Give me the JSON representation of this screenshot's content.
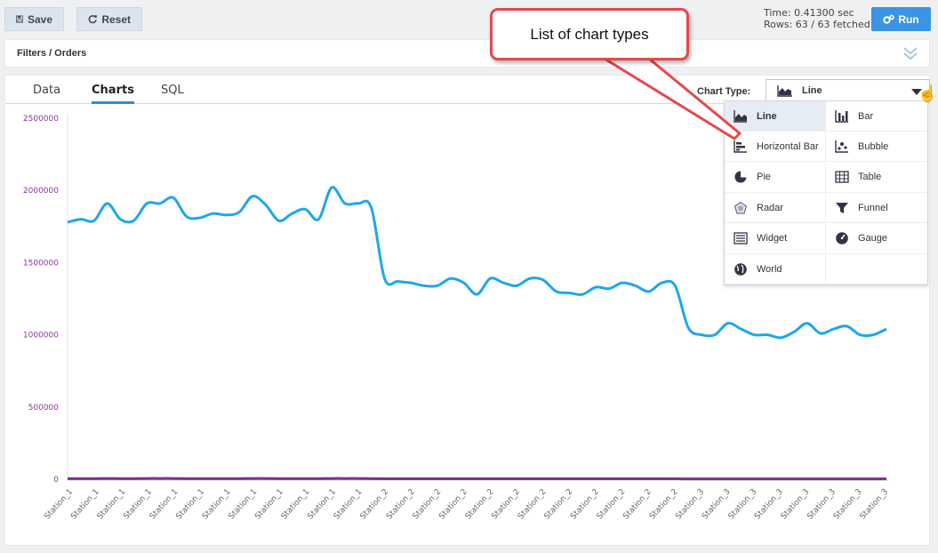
{
  "toolbar": {
    "save_label": "Save",
    "reset_label": "Reset",
    "time_text": "Time: 0.41300 sec",
    "rows_text": "Rows: 63 / 63 fetched",
    "run_label": "Run"
  },
  "filters": {
    "label": "Filters / Orders"
  },
  "tabs": [
    {
      "label": "Data",
      "active": false
    },
    {
      "label": "Charts",
      "active": true
    },
    {
      "label": "SQL",
      "active": false
    }
  ],
  "chart_type": {
    "label": "Chart Type:",
    "selected": "Line"
  },
  "dropdown": {
    "items": [
      {
        "label": "Line",
        "icon": "area-chart-icon",
        "selected": true
      },
      {
        "label": "Bar",
        "icon": "bar-chart-icon",
        "selected": false
      },
      {
        "label": "Horizontal Bar",
        "icon": "horizontal-bar-icon",
        "selected": false
      },
      {
        "label": "Bubble",
        "icon": "bubble-chart-icon",
        "selected": false
      },
      {
        "label": "Pie",
        "icon": "pie-chart-icon",
        "selected": false
      },
      {
        "label": "Table",
        "icon": "table-icon",
        "selected": false
      },
      {
        "label": "Radar",
        "icon": "radar-icon",
        "selected": false
      },
      {
        "label": "Funnel",
        "icon": "funnel-icon",
        "selected": false
      },
      {
        "label": "Widget",
        "icon": "widget-icon",
        "selected": false
      },
      {
        "label": "Gauge",
        "icon": "gauge-icon",
        "selected": false
      },
      {
        "label": "World",
        "icon": "globe-icon",
        "selected": false
      }
    ]
  },
  "callout": {
    "text": "List of chart types"
  },
  "colors": {
    "accent": "#2a8fd8",
    "run_button": "#3a95e4",
    "series_primary": "#1ea7ea",
    "series_secondary": "#7b2e96",
    "y_tick_text": "#8b3a9a",
    "callout_border": "#e5484b"
  },
  "chart_data": {
    "type": "line",
    "ylim": [
      0,
      2500000
    ],
    "yticks": [
      "0",
      "500000",
      "1000000",
      "1500000",
      "2000000",
      "2500000"
    ],
    "xticks": [
      "Station_1",
      "Station_1",
      "Station_1",
      "Station_1",
      "Station_1",
      "Station_1",
      "Station_1",
      "Station_1",
      "Station_1",
      "Station_1",
      "Station_1",
      "Station_1",
      "Station_2",
      "Station_2",
      "Station_2",
      "Station_2",
      "Station_2",
      "Station_2",
      "Station_2",
      "Station_2",
      "Station_2",
      "Station_2",
      "Station_2",
      "Station_2",
      "Station_3",
      "Station_3",
      "Station_3",
      "Station_3",
      "Station_3",
      "Station_3",
      "Station_3",
      "Station_3"
    ],
    "series": [
      {
        "values": [
          1780000,
          1800000,
          1790000,
          1910000,
          1800000,
          1790000,
          1910000,
          1910000,
          1950000,
          1820000,
          1810000,
          1840000,
          1830000,
          1850000,
          1960000,
          1900000,
          1790000,
          1840000,
          1870000,
          1800000,
          2020000,
          1910000,
          1910000,
          1880000,
          1390000,
          1370000,
          1360000,
          1340000,
          1340000,
          1390000,
          1360000,
          1280000,
          1390000,
          1360000,
          1340000,
          1390000,
          1380000,
          1300000,
          1290000,
          1280000,
          1330000,
          1320000,
          1360000,
          1340000,
          1300000,
          1360000,
          1340000,
          1050000,
          1000000,
          1000000,
          1080000,
          1040000,
          1000000,
          1000000,
          980000,
          1020000,
          1080000,
          1010000,
          1040000,
          1060000,
          1000000,
          1000000,
          1040000
        ],
        "color": "#1ea7ea"
      },
      {
        "values": [
          4000,
          4000,
          4000,
          5000,
          4000,
          4000,
          5000,
          5000,
          5000,
          4000,
          4000,
          4000,
          4000,
          4000,
          5000,
          5000,
          4000,
          4000,
          4000,
          4000,
          5000,
          5000,
          5000,
          4000,
          3000,
          3000,
          3000,
          3000,
          3000,
          3000,
          3000,
          3000,
          3000,
          3000,
          3000,
          3000,
          3000,
          3000,
          3000,
          3000,
          3000,
          3000,
          3000,
          3000,
          3000,
          3000,
          3000,
          2000,
          2000,
          2000,
          2000,
          2000,
          2000,
          2000,
          2000,
          2000,
          2000,
          2000,
          2000,
          2000,
          2000,
          2000,
          2000
        ],
        "color": "#7b2e96"
      }
    ]
  }
}
